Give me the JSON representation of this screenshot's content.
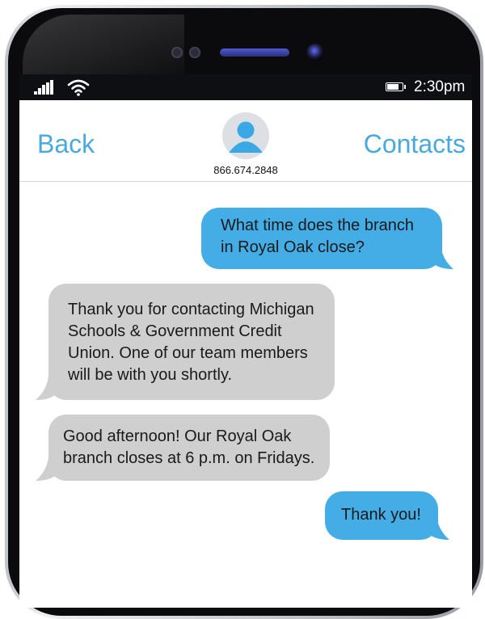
{
  "status": {
    "time": "2:30pm",
    "signal": "signal-bars-icon",
    "wifi": "wifi-icon",
    "battery": "battery-icon"
  },
  "nav": {
    "back_label": "Back",
    "contacts_label": "Contacts",
    "phone_number": "866.674.2848",
    "avatar_icon": "user-avatar-icon"
  },
  "messages": [
    {
      "side": "sent",
      "text": "What time does the branch in Royal Oak close?"
    },
    {
      "side": "received",
      "text": "Thank you for contacting Michigan Schools & Government Credit Union. One of our team members will be with you shortly."
    },
    {
      "side": "received",
      "text": "Good afternoon! Our Royal Oak branch closes at 6 p.m. on Fridays."
    },
    {
      "side": "sent",
      "text": "Thank you!"
    }
  ],
  "colors": {
    "sent_bubble": "#45ade5",
    "received_bubble": "#cfcfcf",
    "accent": "#4aa9dc"
  }
}
